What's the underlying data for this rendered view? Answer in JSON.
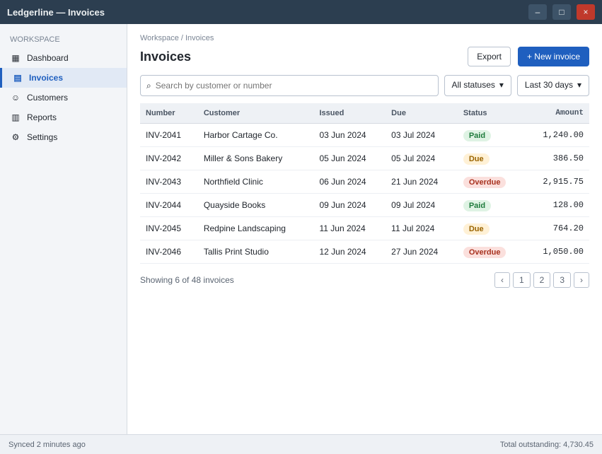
{
  "window": {
    "title": "Ledgerline — Invoices",
    "minimize_glyph": "–",
    "maximize_glyph": "□",
    "close_glyph": "×"
  },
  "sidebar": {
    "section_label": "Workspace",
    "items": [
      {
        "label": "Dashboard",
        "glyph": "▦",
        "icon": "dashboard-icon"
      },
      {
        "label": "Invoices",
        "glyph": "▤",
        "icon": "invoice-icon"
      },
      {
        "label": "Customers",
        "glyph": "☺",
        "icon": "customers-icon"
      },
      {
        "label": "Reports",
        "glyph": "▥",
        "icon": "reports-icon"
      },
      {
        "label": "Settings",
        "glyph": "⚙",
        "icon": "gear-icon"
      }
    ]
  },
  "main": {
    "breadcrumb": "Workspace / Invoices",
    "title": "Invoices",
    "export_label": "Export",
    "new_label": "+ New invoice",
    "search_placeholder": "Search by customer or number",
    "search_glyph": "⌕",
    "status_filter": "All statuses",
    "date_filter": "Last 30 days",
    "chevron": "▾",
    "columns": [
      "Number",
      "Customer",
      "Issued",
      "Due",
      "Status",
      "Amount"
    ],
    "rows": [
      [
        "INV-2041",
        "Harbor Cartage Co.",
        "03 Jun 2024",
        "03 Jul 2024",
        "Paid",
        "1,240.00"
      ],
      [
        "INV-2042",
        "Miller & Sons Bakery",
        "05 Jun 2024",
        "05 Jul 2024",
        "Due",
        "386.50"
      ],
      [
        "INV-2043",
        "Northfield Clinic",
        "06 Jun 2024",
        "21 Jun 2024",
        "Overdue",
        "2,915.75"
      ],
      [
        "INV-2044",
        "Quayside Books",
        "09 Jun 2024",
        "09 Jul 2024",
        "Paid",
        "128.00"
      ],
      [
        "INV-2045",
        "Redpine Landscaping",
        "11 Jun 2024",
        "11 Jul 2024",
        "Due",
        "764.20"
      ],
      [
        "INV-2046",
        "Tallis Print Studio",
        "12 Jun 2024",
        "27 Jun 2024",
        "Overdue",
        "1,050.00"
      ]
    ],
    "summary": "Showing 6 of 48 invoices",
    "pages": [
      "‹",
      "1",
      "2",
      "3",
      "›"
    ]
  },
  "status": {
    "left": "Synced 2 minutes ago",
    "right": "Total outstanding: 4,730.45"
  },
  "colors": {
    "accent": "#1f5fbf",
    "titlebar": "#2c3e50"
  }
}
